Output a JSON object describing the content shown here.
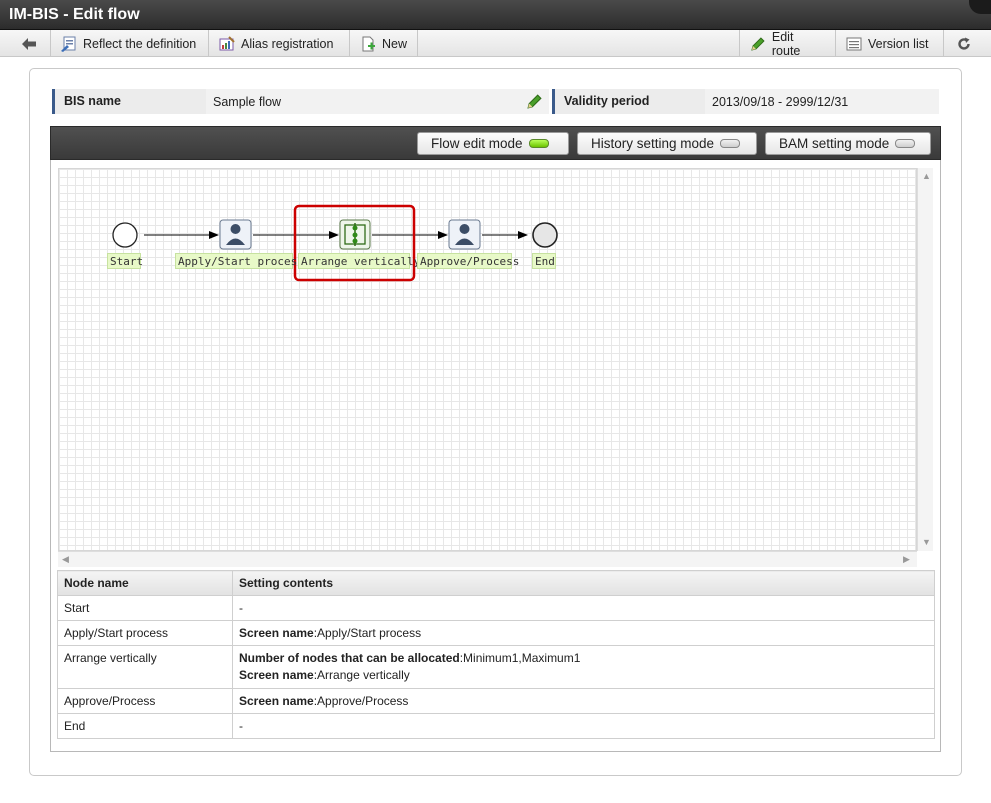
{
  "window": {
    "title": "IM-BIS - Edit flow"
  },
  "toolbar": {
    "reflect_label": "Reflect the definition",
    "alias_label": "Alias registration",
    "new_label": "New",
    "edit_route_label": "Edit route",
    "version_list_label": "Version list"
  },
  "info": {
    "bis_name_label": "BIS name",
    "bis_name_value": "Sample flow",
    "validity_label": "Validity period",
    "validity_value": "2013/09/18 - 2999/12/31"
  },
  "modes": {
    "flow_edit": "Flow edit mode",
    "history": "History setting mode",
    "bam": "BAM setting mode"
  },
  "flow": {
    "nodes": [
      "Start",
      "Apply/Start process",
      "Arrange vertically",
      "Approve/Process",
      "End"
    ],
    "highlighted": "Arrange vertically"
  },
  "table": {
    "headers": [
      "Node name",
      "Setting contents"
    ],
    "rows": [
      {
        "node": "Start",
        "setting": "-"
      },
      {
        "node": "Apply/Start process",
        "k1": "Screen name",
        "v1": ":Apply/Start process"
      },
      {
        "node": "Arrange vertically",
        "k1": "Number of nodes that can be allocated",
        "v1": ":Minimum1,Maximum1",
        "k2": "Screen name",
        "v2": ":Arrange vertically"
      },
      {
        "node": "Approve/Process",
        "k1": "Screen name",
        "v1": ":Approve/Process"
      },
      {
        "node": "End",
        "setting": "-"
      }
    ]
  },
  "colors": {
    "accent": "#3a5a8a",
    "highlight": "#cc0000",
    "lamp_on": "#7cd400",
    "label_bg": "#e8f9c8"
  }
}
